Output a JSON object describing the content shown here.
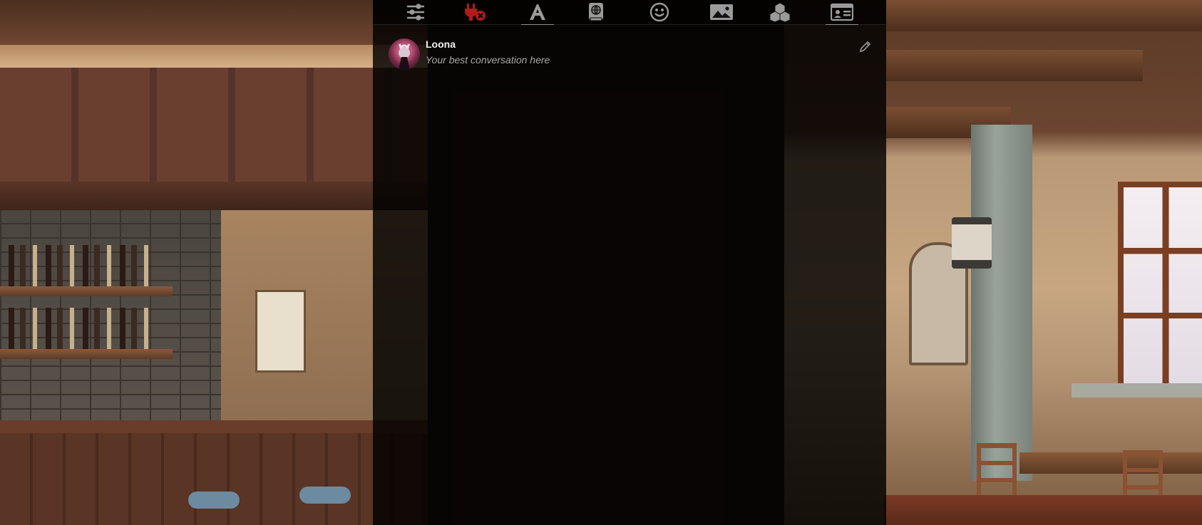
{
  "toolbar": {
    "tabs": [
      {
        "name": "ai-settings",
        "icon": "sliders-icon",
        "active": false
      },
      {
        "name": "api-connections",
        "icon": "plug-icon",
        "active": false,
        "color": "#b01c1c"
      },
      {
        "name": "formatting",
        "icon": "font-icon",
        "active": false
      },
      {
        "name": "world-info",
        "icon": "book-globe-icon",
        "active": false
      },
      {
        "name": "user-settings",
        "icon": "smiley-icon",
        "active": false
      },
      {
        "name": "backgrounds",
        "icon": "image-icon",
        "active": false
      },
      {
        "name": "extensions",
        "icon": "cubes-icon",
        "active": false
      },
      {
        "name": "character-management",
        "icon": "id-card-icon",
        "active": false
      }
    ],
    "icon_color": "#9a9a9a"
  },
  "character": {
    "name": "Loona",
    "tagline": "Your best conversation here"
  },
  "colors": {
    "panel_bg": "rgba(0,0,0,0.82)",
    "accent_red": "#b01c1c"
  }
}
